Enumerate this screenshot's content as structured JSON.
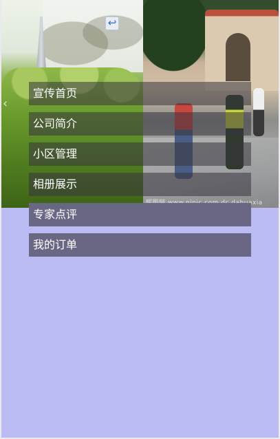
{
  "navigation": {
    "back_icon": "back-arrow-icon",
    "back_glyph": "↩",
    "side_icon": "chevron-left-icon",
    "side_glyph": "‹"
  },
  "banner": {
    "watermark": "昵图网 www.nipic.com  dc.dahuaxia"
  },
  "menu": {
    "items": [
      {
        "label": "宣传首页"
      },
      {
        "label": "公司简介"
      },
      {
        "label": "小区管理"
      },
      {
        "label": "相册展示"
      },
      {
        "label": "专家点评"
      },
      {
        "label": "我的订单"
      }
    ]
  },
  "colors": {
    "background": "#bcbcf5",
    "menu_overlay": "#37343e",
    "menu_solid": "#6a6785"
  }
}
